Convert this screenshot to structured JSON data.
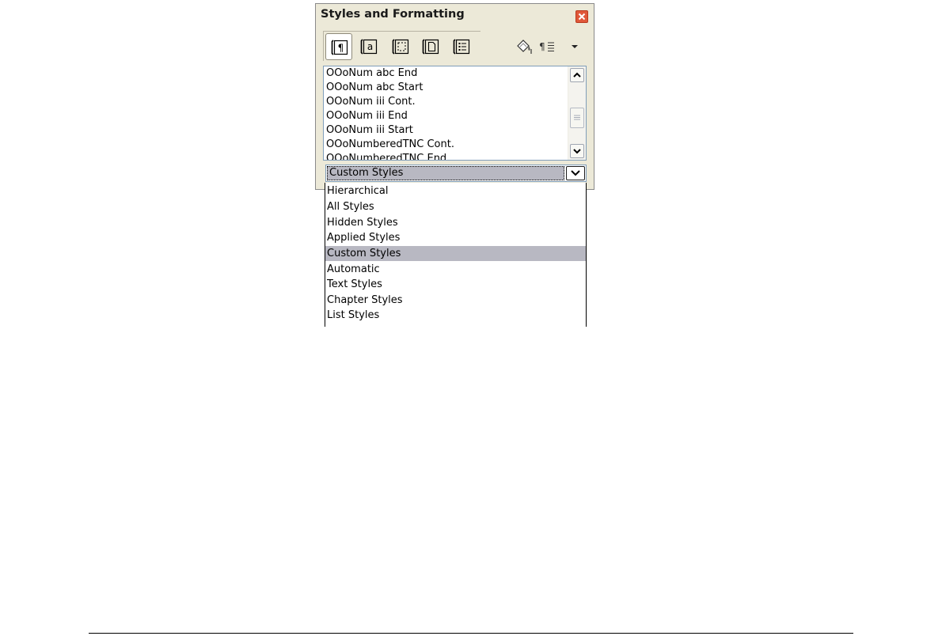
{
  "window": {
    "title": "Styles and Formatting"
  },
  "toolbar": {
    "buttons": [
      {
        "icon": "paragraph-styles-icon",
        "active": true
      },
      {
        "icon": "character-styles-icon",
        "active": false
      },
      {
        "icon": "frame-styles-icon",
        "active": false
      },
      {
        "icon": "page-styles-icon",
        "active": false
      },
      {
        "icon": "list-styles-icon",
        "active": false
      }
    ],
    "right_icons": [
      "fill-format-mode-icon",
      "new-style-from-selection-icon",
      "dropdown-arrow-icon"
    ]
  },
  "style_list": {
    "items": [
      "OOoNum abc End",
      "OOoNum abc Start",
      "OOoNum iii Cont.",
      "OOoNum iii End",
      "OOoNum iii Start",
      "OOoNumberedTNC Cont.",
      "OOoNumberedTNC End"
    ]
  },
  "filter": {
    "selected": "Custom Styles",
    "options": [
      "Hierarchical",
      "All Styles",
      "Hidden Styles",
      "Applied Styles",
      "Custom Styles",
      "Automatic",
      "Text Styles",
      "Chapter Styles",
      "List Styles"
    ]
  }
}
